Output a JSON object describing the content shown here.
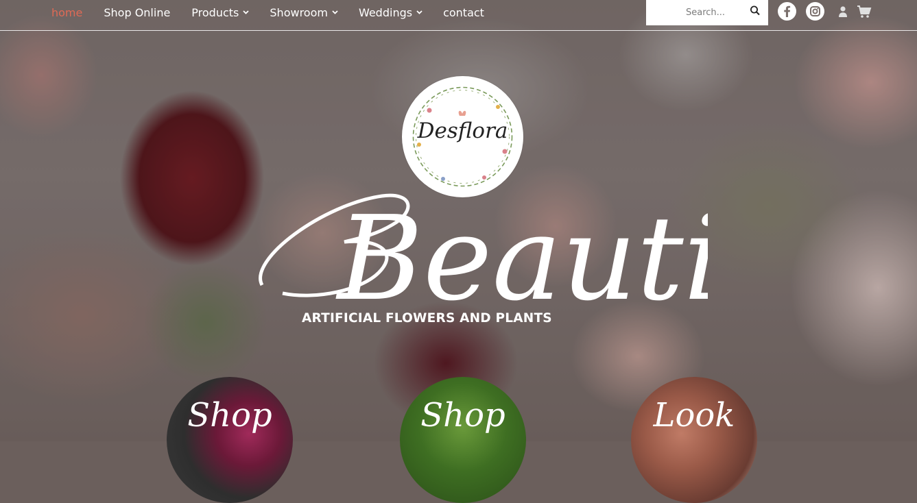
{
  "nav": {
    "items": [
      {
        "label": "home",
        "active": true,
        "has_dropdown": false
      },
      {
        "label": "Shop Online",
        "active": false,
        "has_dropdown": false
      },
      {
        "label": "Products",
        "active": false,
        "has_dropdown": true
      },
      {
        "label": "Showroom",
        "active": false,
        "has_dropdown": true
      },
      {
        "label": "Weddings",
        "active": false,
        "has_dropdown": true
      },
      {
        "label": "contact",
        "active": false,
        "has_dropdown": false
      }
    ],
    "active_color": "#e06a55"
  },
  "search": {
    "placeholder": "Search...",
    "icon": "search-icon"
  },
  "icons": {
    "facebook": "facebook-icon",
    "instagram": "instagram-icon",
    "user": "user-icon",
    "cart": "cart-icon"
  },
  "logo": {
    "text": "Desflora"
  },
  "hero": {
    "title": "Beautiful",
    "subtitle": "ARTIFICIAL FLOWERS AND PLANTS"
  },
  "circles": [
    {
      "label": "Shop"
    },
    {
      "label": "Shop"
    },
    {
      "label": "Look"
    }
  ]
}
